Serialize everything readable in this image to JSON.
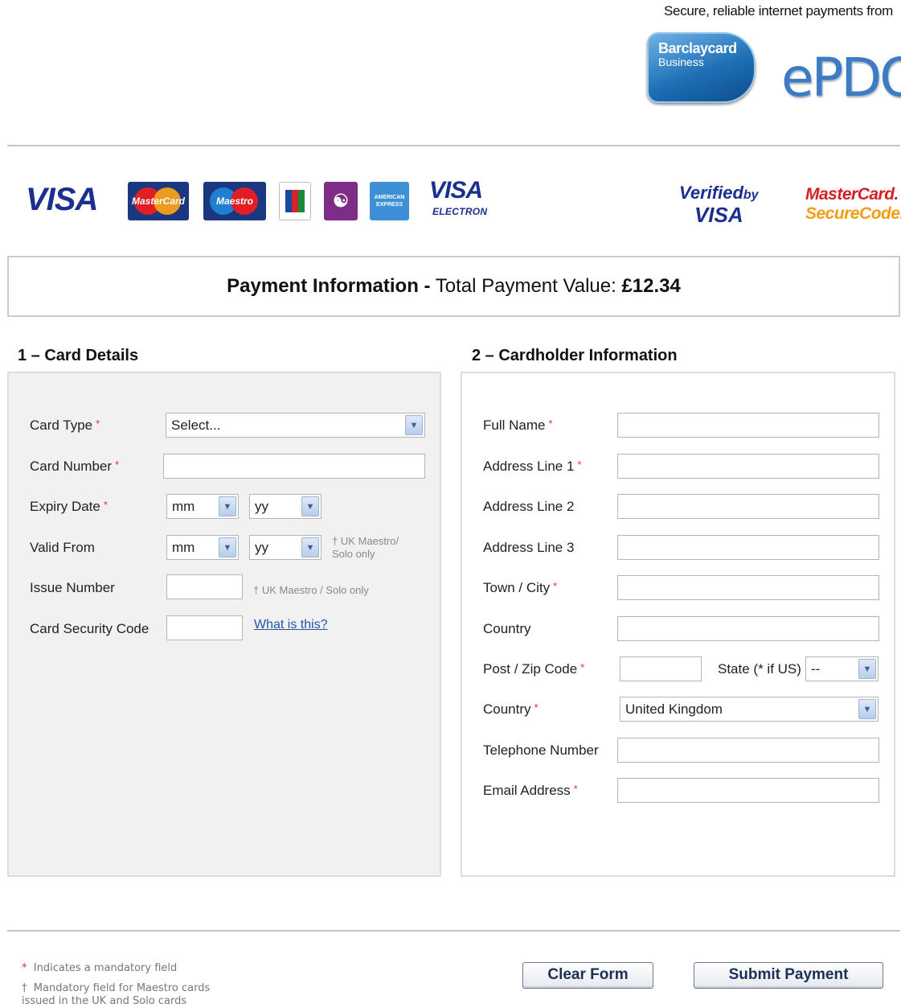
{
  "header": {
    "tagline": "Secure, reliable internet payments from",
    "barclaycard_line1": "Barclaycard",
    "barclaycard_line2": "Business",
    "epdq": "ePDQ"
  },
  "card_logos": {
    "visa": "VISA",
    "mastercard": "MasterCard",
    "maestro": "Maestro",
    "jcb": "JCB",
    "solo": "SOLO",
    "amex": "AMERICAN EXPRESS",
    "visa_electron_1": "VISA",
    "visa_electron_2": "ELECTRON",
    "vbv_1": "Verified",
    "vbv_by": "by",
    "vbv_2": "VISA",
    "mcsc_1": "MasterCard.",
    "mcsc_2": "SecureCode."
  },
  "payment_info": {
    "title": "Payment Information -",
    "value_label": "Total Payment Value:",
    "value": "£12.34"
  },
  "card_details": {
    "heading": "1 – Card Details",
    "card_type_label": "Card Type",
    "card_type_value": "Select...",
    "card_number_label": "Card Number",
    "expiry_label": "Expiry Date",
    "expiry_month": "mm",
    "expiry_year": "yy",
    "valid_from_label": "Valid From",
    "valid_from_month": "mm",
    "valid_from_year": "yy",
    "valid_from_note_1": "† UK Maestro/",
    "valid_from_note_2": "Solo only",
    "issue_number_label": "Issue Number",
    "issue_number_note": "† UK Maestro / Solo only",
    "csc_label": "Card Security Code",
    "csc_link": "What is this?",
    "required_mark": "*"
  },
  "cardholder": {
    "heading": "2 – Cardholder Information",
    "full_name_label": "Full Name",
    "address1_label": "Address Line 1",
    "address2_label": "Address Line 2",
    "address3_label": "Address Line 3",
    "town_label": "Town / City",
    "county_label": "Country",
    "postcode_label": "Post / Zip Code",
    "state_label": "State (* if US)",
    "state_value": "--",
    "country_label": "Country",
    "country_value": "United Kingdom",
    "telephone_label": "Telephone Number",
    "email_label": "Email Address",
    "required_mark": "*"
  },
  "footer": {
    "note_mandatory_mark": "*",
    "note_mandatory": "Indicates a mandatory field",
    "note_maestro_mark": "†",
    "note_maestro_1": "Mandatory field for Maestro cards",
    "note_maestro_2": "issued in the UK and Solo cards",
    "clear_button": "Clear Form",
    "submit_button": "Submit Payment"
  },
  "colors": {
    "required": "#e03030",
    "link": "#2255aa",
    "panel_bg": "#f1f1f1"
  }
}
